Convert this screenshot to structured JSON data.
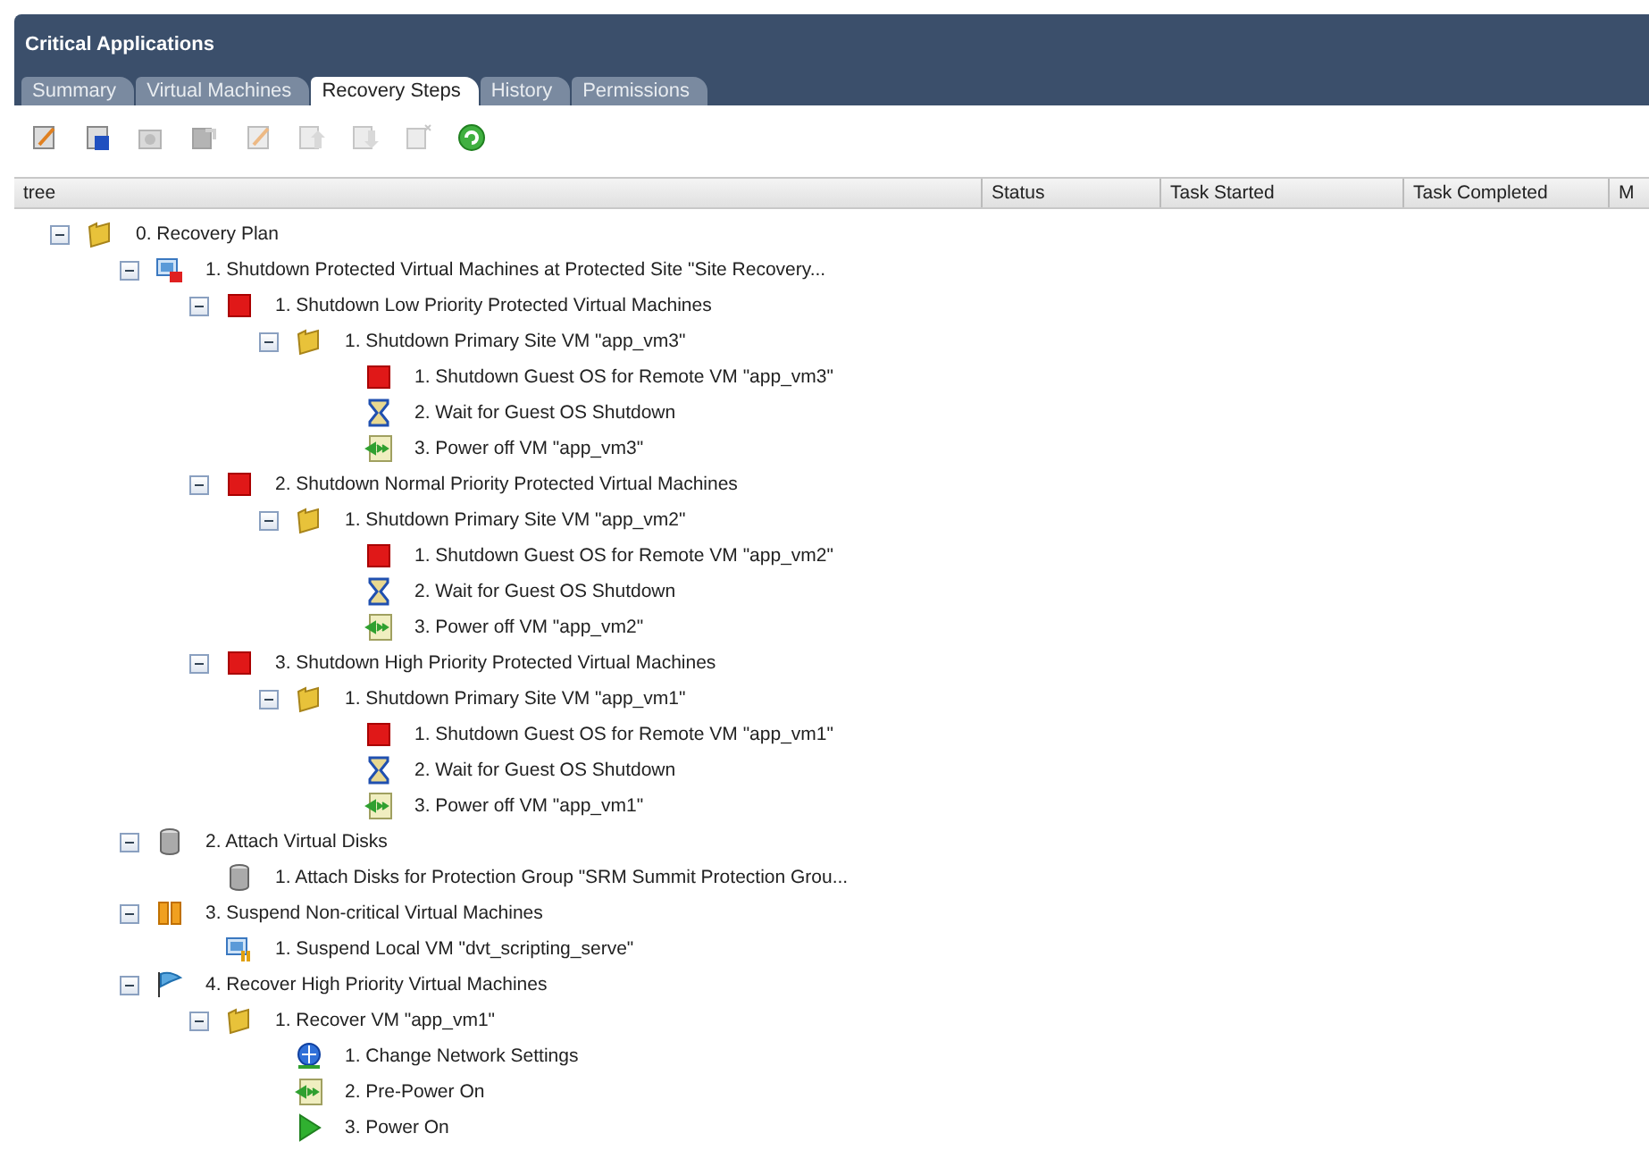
{
  "window": {
    "title": "Critical Applications"
  },
  "tabs": [
    {
      "label": "Summary",
      "selected": false
    },
    {
      "label": "Virtual Machines",
      "selected": false
    },
    {
      "label": "Recovery Steps",
      "selected": true
    },
    {
      "label": "History",
      "selected": false
    },
    {
      "label": "Permissions",
      "selected": false
    }
  ],
  "toolbar": [
    {
      "kind": "edit",
      "disabled": false
    },
    {
      "kind": "save",
      "disabled": false
    },
    {
      "kind": "camera",
      "disabled": true
    },
    {
      "kind": "export",
      "disabled": true
    },
    {
      "kind": "edit",
      "disabled": true
    },
    {
      "kind": "up",
      "disabled": true
    },
    {
      "kind": "down",
      "disabled": true
    },
    {
      "kind": "remove",
      "disabled": true
    },
    {
      "kind": "refresh",
      "disabled": false
    }
  ],
  "table": {
    "columns": [
      "tree",
      "Status",
      "Task Started",
      "Task Completed",
      "M"
    ],
    "tree": [
      {
        "kind": "folder",
        "label": "0. Recovery Plan",
        "expanded": true,
        "children": [
          {
            "kind": "site",
            "label": "1. Shutdown Protected Virtual Machines at Protected Site \"Site Recovery...",
            "expanded": true,
            "children": [
              {
                "kind": "stop",
                "label": "1. Shutdown Low Priority Protected Virtual Machines",
                "expanded": true,
                "children": [
                  {
                    "kind": "folder",
                    "label": "1. Shutdown Primary Site VM \"app_vm3\"",
                    "expanded": true,
                    "children": [
                      {
                        "kind": "stop",
                        "label": "1. Shutdown Guest OS for Remote VM \"app_vm3\""
                      },
                      {
                        "kind": "hourglass",
                        "label": "2. Wait for Guest OS Shutdown"
                      },
                      {
                        "kind": "script",
                        "label": "3. Power off VM \"app_vm3\""
                      }
                    ]
                  }
                ]
              },
              {
                "kind": "stop",
                "label": "2. Shutdown Normal Priority Protected Virtual Machines",
                "expanded": true,
                "children": [
                  {
                    "kind": "folder",
                    "label": "1. Shutdown Primary Site VM \"app_vm2\"",
                    "expanded": true,
                    "children": [
                      {
                        "kind": "stop",
                        "label": "1. Shutdown Guest OS for Remote VM \"app_vm2\""
                      },
                      {
                        "kind": "hourglass",
                        "label": "2. Wait for Guest OS Shutdown"
                      },
                      {
                        "kind": "script",
                        "label": "3. Power off VM \"app_vm2\""
                      }
                    ]
                  }
                ]
              },
              {
                "kind": "stop",
                "label": "3. Shutdown High Priority Protected Virtual Machines",
                "expanded": true,
                "children": [
                  {
                    "kind": "folder",
                    "label": "1. Shutdown Primary Site VM \"app_vm1\"",
                    "expanded": true,
                    "children": [
                      {
                        "kind": "stop",
                        "label": "1. Shutdown Guest OS for Remote VM \"app_vm1\""
                      },
                      {
                        "kind": "hourglass",
                        "label": "2. Wait for Guest OS Shutdown"
                      },
                      {
                        "kind": "script",
                        "label": "3. Power off VM \"app_vm1\""
                      }
                    ]
                  }
                ]
              }
            ]
          },
          {
            "kind": "disk",
            "label": "2. Attach Virtual Disks",
            "expanded": true,
            "children": [
              {
                "kind": "disk",
                "label": "1. Attach Disks for Protection Group \"SRM Summit Protection Grou..."
              }
            ]
          },
          {
            "kind": "pause",
            "label": "3. Suspend Non-critical Virtual Machines",
            "expanded": true,
            "children": [
              {
                "kind": "vmpause",
                "label": "1. Suspend Local VM \"dvt_scripting_serve\""
              }
            ]
          },
          {
            "kind": "flag",
            "label": "4. Recover High Priority Virtual Machines",
            "expanded": true,
            "children": [
              {
                "kind": "folder",
                "label": "1. Recover VM \"app_vm1\"",
                "expanded": true,
                "children": [
                  {
                    "kind": "network",
                    "label": "1. Change Network Settings"
                  },
                  {
                    "kind": "script",
                    "label": "2. Pre-Power On"
                  },
                  {
                    "kind": "play",
                    "label": "3. Power On"
                  }
                ]
              }
            ]
          }
        ]
      }
    ]
  }
}
